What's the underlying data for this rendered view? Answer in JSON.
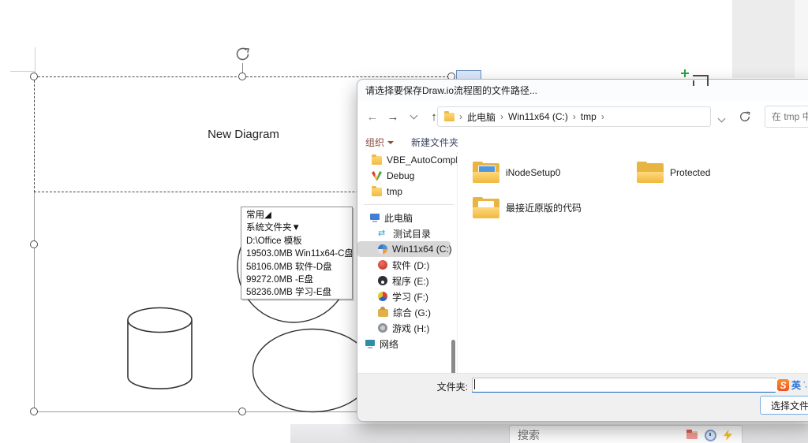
{
  "canvas": {
    "diagram_title": "New Diagram",
    "popup": {
      "lines": [
        "常用◢",
        "系统文件夹▼",
        "D:\\Office 模板",
        "19503.0MB Win11x64-C盘",
        "58106.0MB 软件-D盘",
        "99272.0MB -E盘",
        "58236.0MB 学习-E盘"
      ]
    }
  },
  "glyphs": {
    "back": "←",
    "forward": "→",
    "up": "↑",
    "shortcut": "⇄"
  },
  "dialog": {
    "title": "请选择要保存Draw.io流程图的文件路径...",
    "breadcrumb": {
      "separator": "›",
      "items": [
        "此电脑",
        "Win11x64 (C:)",
        "tmp"
      ]
    },
    "search_placeholder": "在 tmp 中搜",
    "toolbar": {
      "organize": "组织",
      "new_folder": "新建文件夹"
    },
    "sidebar": {
      "pinned": [
        {
          "label": "VBE_AutoCompl"
        },
        {
          "label": "Debug"
        },
        {
          "label": "tmp"
        }
      ],
      "tree": [
        {
          "label": "此电脑"
        },
        {
          "label": "测试目录"
        },
        {
          "label": "Win11x64 (C:)"
        },
        {
          "label": "软件 (D:)"
        },
        {
          "label": "程序 (E:)"
        },
        {
          "label": "学习 (F:)"
        },
        {
          "label": "综合 (G:)"
        },
        {
          "label": "游戏 (H:)"
        }
      ],
      "network": {
        "label": "网络"
      }
    },
    "files": [
      {
        "name": "iNodeSetup0"
      },
      {
        "name": "Protected"
      },
      {
        "name": "最接近原版的代码"
      }
    ],
    "footer": {
      "folder_label": "文件夹:",
      "folder_value": "",
      "select_button": "选择文件夹"
    },
    "ime": {
      "logo": "S",
      "mode": "英",
      "punct": "’,"
    }
  },
  "bottom_bar": {
    "search_placeholder": "搜索"
  },
  "colors": {
    "accent_blue": "#0b64c0",
    "folder_yellow": "#f0ba45",
    "sogou_orange": "#ef5423"
  }
}
